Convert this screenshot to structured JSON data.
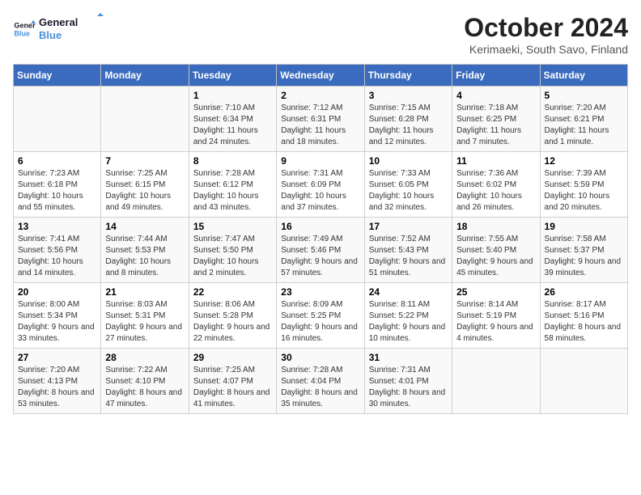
{
  "header": {
    "logo_line1": "General",
    "logo_line2": "Blue",
    "month_title": "October 2024",
    "subtitle": "Kerimaeki, South Savo, Finland"
  },
  "weekdays": [
    "Sunday",
    "Monday",
    "Tuesday",
    "Wednesday",
    "Thursday",
    "Friday",
    "Saturday"
  ],
  "weeks": [
    [
      {
        "day": "",
        "info": ""
      },
      {
        "day": "",
        "info": ""
      },
      {
        "day": "1",
        "info": "Sunrise: 7:10 AM\nSunset: 6:34 PM\nDaylight: 11 hours and 24 minutes."
      },
      {
        "day": "2",
        "info": "Sunrise: 7:12 AM\nSunset: 6:31 PM\nDaylight: 11 hours and 18 minutes."
      },
      {
        "day": "3",
        "info": "Sunrise: 7:15 AM\nSunset: 6:28 PM\nDaylight: 11 hours and 12 minutes."
      },
      {
        "day": "4",
        "info": "Sunrise: 7:18 AM\nSunset: 6:25 PM\nDaylight: 11 hours and 7 minutes."
      },
      {
        "day": "5",
        "info": "Sunrise: 7:20 AM\nSunset: 6:21 PM\nDaylight: 11 hours and 1 minute."
      }
    ],
    [
      {
        "day": "6",
        "info": "Sunrise: 7:23 AM\nSunset: 6:18 PM\nDaylight: 10 hours and 55 minutes."
      },
      {
        "day": "7",
        "info": "Sunrise: 7:25 AM\nSunset: 6:15 PM\nDaylight: 10 hours and 49 minutes."
      },
      {
        "day": "8",
        "info": "Sunrise: 7:28 AM\nSunset: 6:12 PM\nDaylight: 10 hours and 43 minutes."
      },
      {
        "day": "9",
        "info": "Sunrise: 7:31 AM\nSunset: 6:09 PM\nDaylight: 10 hours and 37 minutes."
      },
      {
        "day": "10",
        "info": "Sunrise: 7:33 AM\nSunset: 6:05 PM\nDaylight: 10 hours and 32 minutes."
      },
      {
        "day": "11",
        "info": "Sunrise: 7:36 AM\nSunset: 6:02 PM\nDaylight: 10 hours and 26 minutes."
      },
      {
        "day": "12",
        "info": "Sunrise: 7:39 AM\nSunset: 5:59 PM\nDaylight: 10 hours and 20 minutes."
      }
    ],
    [
      {
        "day": "13",
        "info": "Sunrise: 7:41 AM\nSunset: 5:56 PM\nDaylight: 10 hours and 14 minutes."
      },
      {
        "day": "14",
        "info": "Sunrise: 7:44 AM\nSunset: 5:53 PM\nDaylight: 10 hours and 8 minutes."
      },
      {
        "day": "15",
        "info": "Sunrise: 7:47 AM\nSunset: 5:50 PM\nDaylight: 10 hours and 2 minutes."
      },
      {
        "day": "16",
        "info": "Sunrise: 7:49 AM\nSunset: 5:46 PM\nDaylight: 9 hours and 57 minutes."
      },
      {
        "day": "17",
        "info": "Sunrise: 7:52 AM\nSunset: 5:43 PM\nDaylight: 9 hours and 51 minutes."
      },
      {
        "day": "18",
        "info": "Sunrise: 7:55 AM\nSunset: 5:40 PM\nDaylight: 9 hours and 45 minutes."
      },
      {
        "day": "19",
        "info": "Sunrise: 7:58 AM\nSunset: 5:37 PM\nDaylight: 9 hours and 39 minutes."
      }
    ],
    [
      {
        "day": "20",
        "info": "Sunrise: 8:00 AM\nSunset: 5:34 PM\nDaylight: 9 hours and 33 minutes."
      },
      {
        "day": "21",
        "info": "Sunrise: 8:03 AM\nSunset: 5:31 PM\nDaylight: 9 hours and 27 minutes."
      },
      {
        "day": "22",
        "info": "Sunrise: 8:06 AM\nSunset: 5:28 PM\nDaylight: 9 hours and 22 minutes."
      },
      {
        "day": "23",
        "info": "Sunrise: 8:09 AM\nSunset: 5:25 PM\nDaylight: 9 hours and 16 minutes."
      },
      {
        "day": "24",
        "info": "Sunrise: 8:11 AM\nSunset: 5:22 PM\nDaylight: 9 hours and 10 minutes."
      },
      {
        "day": "25",
        "info": "Sunrise: 8:14 AM\nSunset: 5:19 PM\nDaylight: 9 hours and 4 minutes."
      },
      {
        "day": "26",
        "info": "Sunrise: 8:17 AM\nSunset: 5:16 PM\nDaylight: 8 hours and 58 minutes."
      }
    ],
    [
      {
        "day": "27",
        "info": "Sunrise: 7:20 AM\nSunset: 4:13 PM\nDaylight: 8 hours and 53 minutes."
      },
      {
        "day": "28",
        "info": "Sunrise: 7:22 AM\nSunset: 4:10 PM\nDaylight: 8 hours and 47 minutes."
      },
      {
        "day": "29",
        "info": "Sunrise: 7:25 AM\nSunset: 4:07 PM\nDaylight: 8 hours and 41 minutes."
      },
      {
        "day": "30",
        "info": "Sunrise: 7:28 AM\nSunset: 4:04 PM\nDaylight: 8 hours and 35 minutes."
      },
      {
        "day": "31",
        "info": "Sunrise: 7:31 AM\nSunset: 4:01 PM\nDaylight: 8 hours and 30 minutes."
      },
      {
        "day": "",
        "info": ""
      },
      {
        "day": "",
        "info": ""
      }
    ]
  ]
}
